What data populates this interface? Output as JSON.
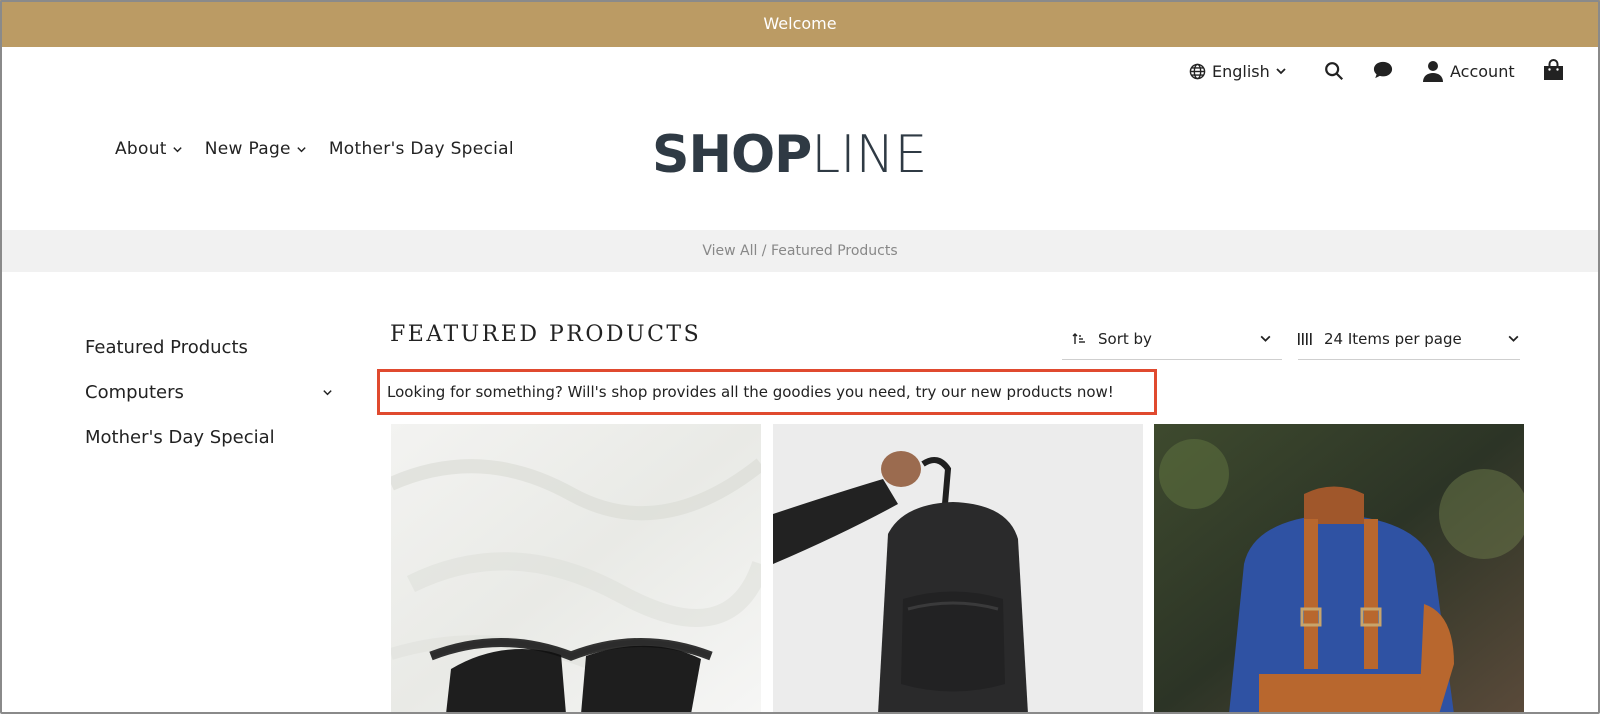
{
  "announcement": "Welcome",
  "utility": {
    "language": "English",
    "account": "Account"
  },
  "nav": {
    "items": [
      {
        "label": "About"
      },
      {
        "label": "New Page"
      },
      {
        "label": "Mother's Day Special"
      }
    ]
  },
  "logo": {
    "bold": "SHOP",
    "light": "LINE"
  },
  "breadcrumb": "View All / Featured Products",
  "sidebar": {
    "items": [
      {
        "label": "Featured Products"
      },
      {
        "label": "Computers"
      },
      {
        "label": "Mother's Day Special"
      }
    ]
  },
  "collection": {
    "title": "FEATURED PRODUCTS",
    "sort_label": "Sort by",
    "items_per_page": "24 Items per page",
    "description": "Looking for something? Will's shop provides all the goodies you need, try our new products now!"
  },
  "colors": {
    "announcement_bg": "#bb9b64",
    "highlight_border": "#e04a2f",
    "breadcrumb_bg": "#f1f1f1",
    "logo": "#2f3a44"
  },
  "icons": [
    "globe-icon",
    "chevron-down-icon",
    "search-icon",
    "chat-icon",
    "user-icon",
    "bag-icon",
    "sort-icon",
    "grid-columns-icon"
  ]
}
